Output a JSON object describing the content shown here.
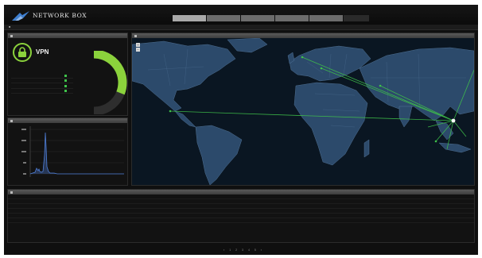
{
  "app": {
    "brand": "NETWORK BOX",
    "tagline": "",
    "colors": {
      "accent": "#8bd23c",
      "link": "#5fa6ff",
      "ok": "#3fc24a"
    }
  },
  "header": {
    "tabs": [
      {
        "label": "",
        "active": true
      },
      {
        "label": "",
        "active": false
      },
      {
        "label": "",
        "active": false
      },
      {
        "label": "",
        "active": false
      },
      {
        "label": "",
        "active": false
      },
      {
        "label": "",
        "active": false
      }
    ]
  },
  "subbar": {
    "left": "■  ",
    "right": [
      "",
      "",
      ""
    ]
  },
  "vpn_panel": {
    "title": "",
    "label": "VPN",
    "columns": [
      "",
      ""
    ],
    "tunnels": [
      {
        "name": "",
        "status": "up"
      },
      {
        "name": "",
        "status": "up"
      },
      {
        "name": "",
        "status": "up"
      },
      {
        "name": "",
        "status": "up"
      }
    ],
    "gauge": {
      "value_text": "",
      "unit": "",
      "fraction": 0.62
    },
    "icon": "lock-icon"
  },
  "connections_panel": {
    "title": ""
  },
  "map_panel": {
    "title": "",
    "zoom_in": "+",
    "zoom_out": "−"
  },
  "table_panel": {
    "title": "",
    "columns": [
      "",
      "",
      "",
      "",
      "",
      "",
      ""
    ],
    "rows": [
      [
        "",
        "",
        "",
        "",
        "",
        "",
        ""
      ],
      [
        "",
        "",
        "",
        "",
        "",
        "",
        ""
      ],
      [
        "",
        "",
        "",
        "",
        "",
        "",
        ""
      ],
      [
        "",
        "",
        "",
        "",
        "",
        "",
        ""
      ],
      [
        "",
        "",
        "",
        "",
        "",
        "",
        ""
      ]
    ]
  },
  "pager": "▪ 1 2 3 4 5 ▪"
}
